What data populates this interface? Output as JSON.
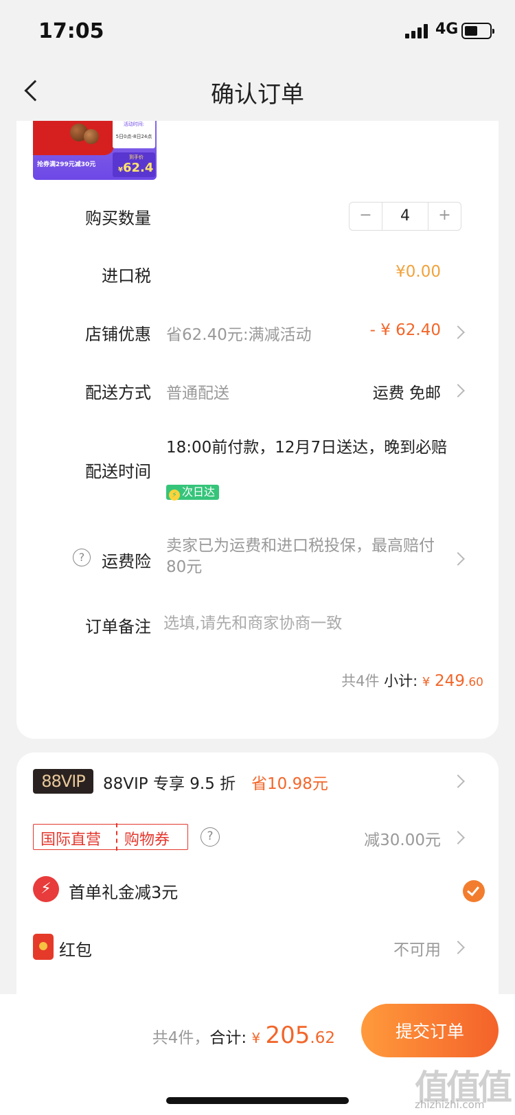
{
  "status_bar": {
    "time": "17:05",
    "network": "4G"
  },
  "nav": {
    "title": "确认订单"
  },
  "product": {
    "promo_time_label": "活动时间:",
    "promo_time": "5日0点-8日24点",
    "coupon_text": "抢券满299元减30元",
    "price_label": "到手价",
    "price_currency": "¥",
    "price": "62.4"
  },
  "quantity": {
    "label": "购买数量",
    "minus": "−",
    "value": "4",
    "plus": "+"
  },
  "tax": {
    "label": "进口税",
    "value": "¥0.00"
  },
  "shop_discount": {
    "label": "店铺优惠",
    "desc": "省62.40元:满减活动",
    "value": "- ¥ 62.40"
  },
  "shipping": {
    "label": "配送方式",
    "method": "普通配送",
    "fee": "运费 免邮"
  },
  "delivery": {
    "label": "配送时间",
    "text": "18:00前付款，12月7日送达，晚到必赔",
    "badge": "次日达"
  },
  "insurance": {
    "label": "运费险",
    "desc": "卖家已为运费和进口税投保，最高赔付80元"
  },
  "note": {
    "label": "订单备注",
    "placeholder": "选填,请先和商家协商一致"
  },
  "subtotal": {
    "count": "共4件",
    "label": "小计:",
    "currency": "¥",
    "int": "249",
    "dec": ".60"
  },
  "vip": {
    "badge": "88VIP",
    "text": "88VIP 专享 9.5 折",
    "save": "省10.98元"
  },
  "coupon": {
    "tag1": "国际直营",
    "tag2": "购物券",
    "value": "减30.00元"
  },
  "gift": {
    "text": "首单礼金减3元",
    "checked": true
  },
  "red_packet": {
    "label": "红包",
    "value": "不可用"
  },
  "total": {
    "count": "共4件，",
    "label": "合计:",
    "currency": "¥",
    "int": "205",
    "dec": ".62"
  },
  "submit": {
    "label": "提交订单"
  },
  "watermark": {
    "logo": "值值值",
    "text": "zhizhizhi.com"
  },
  "colors": {
    "accent": "#f2662a",
    "tax": "#f0a23c",
    "button_start": "#ff9a3c",
    "button_end": "#f4622a",
    "next_day": "#36c47a"
  }
}
